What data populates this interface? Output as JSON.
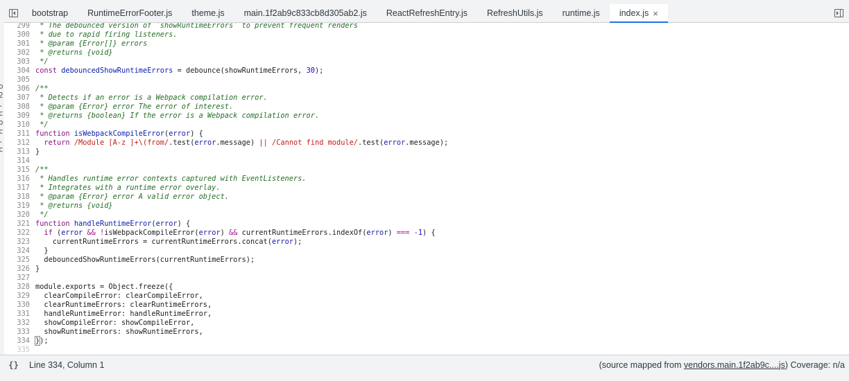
{
  "tabs": [
    {
      "label": "bootstrap"
    },
    {
      "label": "RuntimeErrorFooter.js"
    },
    {
      "label": "theme.js"
    },
    {
      "label": "main.1f2ab9c833cb8d305ab2.js"
    },
    {
      "label": "ReactRefreshEntry.js"
    },
    {
      "label": "RefreshUtils.js"
    },
    {
      "label": "runtime.js"
    },
    {
      "label": "index.js",
      "active": true,
      "close": "×"
    }
  ],
  "left_edge_fragments": [
    "o",
    "2",
    ".",
    "c",
    "o",
    "c",
    ".",
    "c"
  ],
  "code_lines": [
    {
      "n": "299",
      "html": "<span class=\"cmt\"> * The debounced version of `showRuntimeErrors` to prevent frequent renders</span>"
    },
    {
      "n": "300",
      "html": "<span class=\"cmt\"> * due to rapid firing listeners.</span>"
    },
    {
      "n": "301",
      "html": "<span class=\"cmt\"> * @param {Error[]} errors</span>"
    },
    {
      "n": "302",
      "html": "<span class=\"cmt\"> * @returns {void}</span>"
    },
    {
      "n": "303",
      "html": "<span class=\"cmt\"> */</span>"
    },
    {
      "n": "304",
      "html": "<span class=\"kw\">const</span> <span class=\"def\">debouncedShowRuntimeErrors</span> = debounce(showRuntimeErrors, <span class=\"num\">30</span>);"
    },
    {
      "n": "305",
      "html": ""
    },
    {
      "n": "306",
      "html": "<span class=\"cmt\">/**</span>"
    },
    {
      "n": "307",
      "html": "<span class=\"cmt\"> * Detects if an error is a Webpack compilation error.</span>"
    },
    {
      "n": "308",
      "html": "<span class=\"cmt\"> * @param {Error} error The error of interest.</span>"
    },
    {
      "n": "309",
      "html": "<span class=\"cmt\"> * @returns {boolean} If the error is a Webpack compilation error.</span>"
    },
    {
      "n": "310",
      "html": "<span class=\"cmt\"> */</span>"
    },
    {
      "n": "311",
      "html": "<span class=\"kw\">function</span> <span class=\"def\">isWebpackCompileError</span>(<span class=\"var\">error</span>) {"
    },
    {
      "n": "312",
      "html": "  <span class=\"kw\">return</span> <span class=\"re\">/Module [A-z ]+\\(from/</span>.test(<span class=\"var\">error</span>.message) <span class=\"op\">||</span> <span class=\"re\">/Cannot find module/</span>.test(<span class=\"var\">error</span>.message);"
    },
    {
      "n": "313",
      "html": "}"
    },
    {
      "n": "314",
      "html": ""
    },
    {
      "n": "315",
      "html": "<span class=\"cmt\">/**</span>"
    },
    {
      "n": "316",
      "html": "<span class=\"cmt\"> * Handles runtime error contexts captured with EventListeners.</span>"
    },
    {
      "n": "317",
      "html": "<span class=\"cmt\"> * Integrates with a runtime error overlay.</span>"
    },
    {
      "n": "318",
      "html": "<span class=\"cmt\"> * @param {Error} error A valid error object.</span>"
    },
    {
      "n": "319",
      "html": "<span class=\"cmt\"> * @returns {void}</span>"
    },
    {
      "n": "320",
      "html": "<span class=\"cmt\"> */</span>"
    },
    {
      "n": "321",
      "html": "<span class=\"kw\">function</span> <span class=\"def\">handleRuntimeError</span>(<span class=\"var\">error</span>) {"
    },
    {
      "n": "322",
      "html": "  <span class=\"kw\">if</span> (<span class=\"var\">error</span> <span class=\"op\">&amp;&amp;</span> <span class=\"op\">!</span>isWebpackCompileError(<span class=\"var\">error</span>) <span class=\"op\">&amp;&amp;</span> currentRuntimeErrors.indexOf(<span class=\"var\">error</span>) <span class=\"op\">===</span> <span class=\"op\">-</span><span class=\"num\">1</span>) {"
    },
    {
      "n": "323",
      "html": "    currentRuntimeErrors = currentRuntimeErrors.concat(<span class=\"var\">error</span>);"
    },
    {
      "n": "324",
      "html": "  }"
    },
    {
      "n": "325",
      "html": "  debouncedShowRuntimeErrors(currentRuntimeErrors);"
    },
    {
      "n": "326",
      "html": "}"
    },
    {
      "n": "327",
      "html": ""
    },
    {
      "n": "328",
      "html": "module.exports = Object.freeze({"
    },
    {
      "n": "329",
      "html": "  clearCompileError: clearCompileError,"
    },
    {
      "n": "330",
      "html": "  clearRuntimeErrors: clearRuntimeErrors,"
    },
    {
      "n": "331",
      "html": "  handleRuntimeError: handleRuntimeError,"
    },
    {
      "n": "332",
      "html": "  showCompileError: showCompileError,"
    },
    {
      "n": "333",
      "html": "  showRuntimeErrors: showRuntimeErrors,"
    },
    {
      "n": "334",
      "html": "<span class=\"cursor-bracket\">}</span>);"
    },
    {
      "n": "335",
      "html": "",
      "faint": true
    }
  ],
  "status": {
    "braces": "{}",
    "position": "Line 334, Column 1",
    "source_prefix": "(source mapped from ",
    "source_link": "vendors.main.1f2ab9c....js",
    "source_suffix": ") Coverage: n/a"
  }
}
